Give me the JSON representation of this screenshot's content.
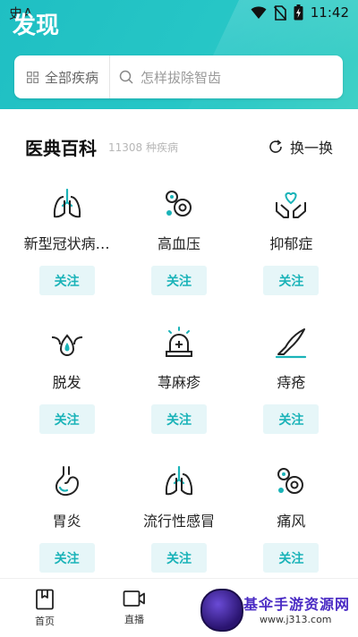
{
  "status_bar": {
    "left_text": "史A",
    "time": "11:42"
  },
  "header": {
    "title": "发现"
  },
  "search": {
    "category_label": "全部疾病",
    "placeholder": "怎样拔除智齿"
  },
  "section": {
    "title": "医典百科",
    "count": "11308 种疾病",
    "refresh_label": "换一换"
  },
  "diseases": [
    {
      "name": "新型冠状病…",
      "icon": "lungs-icon",
      "follow_label": "关注"
    },
    {
      "name": "高血压",
      "icon": "blood-cells-icon",
      "follow_label": "关注"
    },
    {
      "name": "抑郁症",
      "icon": "heart-hands-icon",
      "follow_label": "关注"
    },
    {
      "name": "脱发",
      "icon": "hair-follicle-icon",
      "follow_label": "关注"
    },
    {
      "name": "荨麻疹",
      "icon": "alarm-light-icon",
      "follow_label": "关注"
    },
    {
      "name": "痔疮",
      "icon": "scalpel-icon",
      "follow_label": "关注"
    },
    {
      "name": "胃炎",
      "icon": "stomach-icon",
      "follow_label": "关注"
    },
    {
      "name": "流行性感冒",
      "icon": "lungs-icon",
      "follow_label": "关注"
    },
    {
      "name": "痛风",
      "icon": "blood-cells-icon",
      "follow_label": "关注"
    }
  ],
  "tabbar": {
    "tabs": [
      {
        "label": "首页",
        "icon": "bookmark-book-icon"
      },
      {
        "label": "直播",
        "icon": "video-camera-icon"
      }
    ]
  },
  "watermark": {
    "title": "基伞手游资源网",
    "url": "www.j313.com"
  },
  "colors": {
    "accent": "#1ab3b8",
    "header": "#22c3c4",
    "follow_bg": "#e6f6f8"
  }
}
